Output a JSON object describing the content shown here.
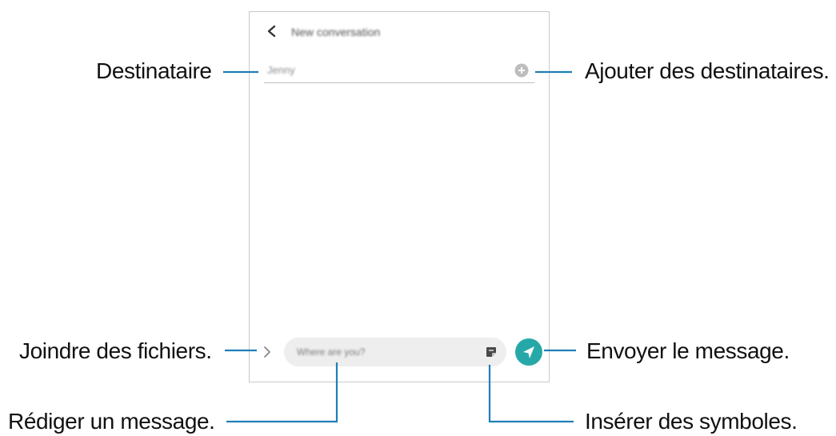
{
  "screen": {
    "title": "New conversation",
    "recipient_value": "Jenny",
    "message_placeholder": "Where are you?"
  },
  "callouts": {
    "recipient": "Destinataire",
    "add_recipients": "Ajouter des destinataires.",
    "attach_files": "Joindre des fichiers.",
    "send_message": "Envoyer le message.",
    "compose_message": "Rédiger un message.",
    "insert_symbols": "Insérer des symboles."
  },
  "colors": {
    "callout_line": "#1f7fb8",
    "send_button": "#27a8a8",
    "add_icon": "#bdbdbd"
  },
  "icons": {
    "back": "chevron-left-icon",
    "add": "plus-circle-icon",
    "attach": "chevron-right-icon",
    "sticker": "sticker-icon",
    "send": "send-icon"
  }
}
